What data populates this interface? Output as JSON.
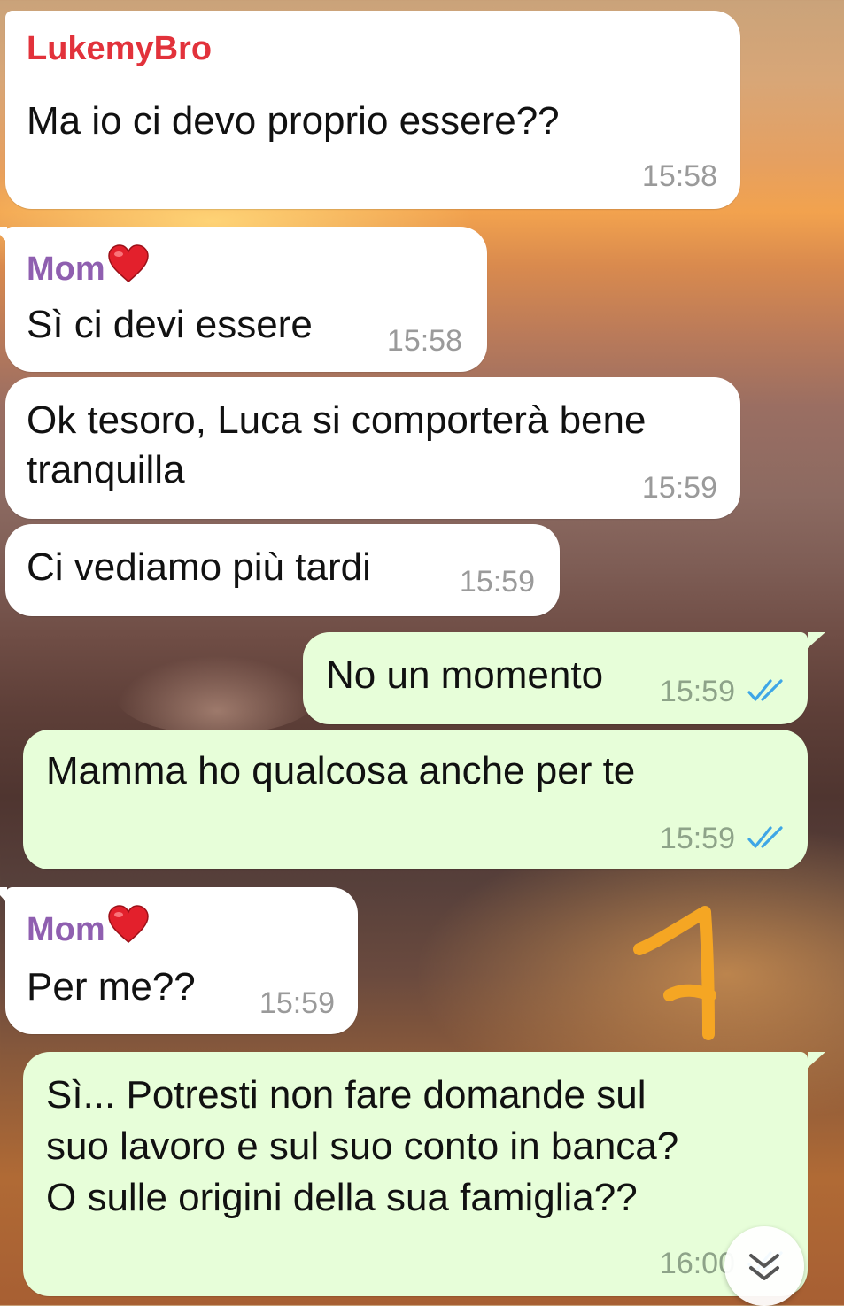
{
  "background": {
    "description_icon": "sunset-beach-wallpaper"
  },
  "colors": {
    "incoming_bubble": "#ffffff",
    "outgoing_bubble": "#e7fed9",
    "sender_lukemybro": "#e2323b",
    "sender_mom": "#8f5fb0",
    "read_ticks": "#3ea6e6",
    "annotation_marker": "#f5a623"
  },
  "messages": [
    {
      "sender": "LukemyBro",
      "text": "Ma io ci devo proprio essere??",
      "time": "15:58"
    },
    {
      "sender": "Mom",
      "sender_icon": "heart-emoji",
      "text": "Sì ci devi essere",
      "time": "15:58"
    },
    {
      "text_line1": "Ok tesoro, Luca si comporterà bene",
      "text_line2": "tranquilla",
      "time": "15:59"
    },
    {
      "text": "Ci vediamo più tardi",
      "time": "15:59"
    },
    {
      "outgoing": true,
      "text": "No un momento",
      "time": "15:59",
      "status_icon": "double-check-read-icon"
    },
    {
      "outgoing": true,
      "text": "Mamma ho qualcosa anche per te",
      "time": "15:59",
      "status_icon": "double-check-read-icon"
    },
    {
      "sender": "Mom",
      "sender_icon": "heart-emoji",
      "text": "Per me??",
      "time": "15:59"
    },
    {
      "outgoing": true,
      "text_line1": "Sì... Potresti non fare domande sul",
      "text_line2": "suo lavoro e sul suo conto in banca?",
      "text_line3": "O sulle origini della sua famiglia??",
      "time": "16:00",
      "status_icon": "double-check-read-icon"
    }
  ],
  "annotation": {
    "text": "7"
  },
  "scroll_button": {
    "icon": "double-chevron-down-icon"
  }
}
